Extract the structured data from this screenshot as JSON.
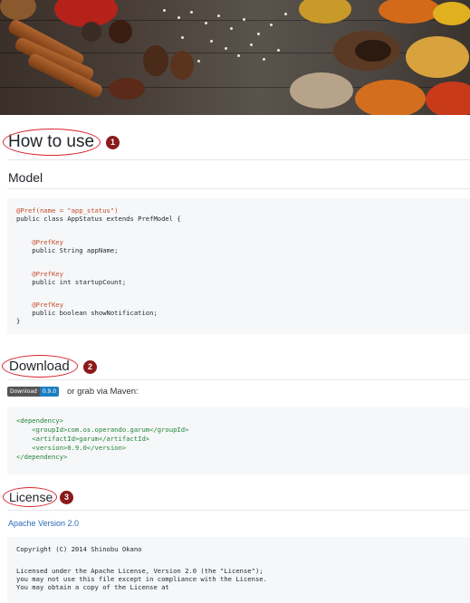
{
  "header_image": {
    "alt": ""
  },
  "sections": {
    "how_to_use": {
      "title": "How to use",
      "badge": "1"
    },
    "model": {
      "title": "Model"
    },
    "download": {
      "title": "Download",
      "badge": "2"
    },
    "license": {
      "title": "License",
      "badge": "3"
    }
  },
  "model_code": [
    "@Pref(name = \"app_status\")",
    "public class AppStatus extends PrefModel {",
    "",
    "    @PrefKey",
    "    public String appName;",
    "",
    "    @PrefKey",
    "    public int startupCount;",
    "",
    "    @PrefKey",
    "    public boolean showNotification;",
    "}"
  ],
  "download": {
    "badge_label": "Download",
    "badge_version": "0.9.0",
    "text": "or grab via Maven:"
  },
  "maven_code": [
    "<dependency>",
    "    <groupId>com.os.operando.garum</groupId>",
    "    <artifactId>garum</artifactId>",
    "    <version>0.9.0</version>",
    "</dependency>"
  ],
  "license": {
    "link_text": "Apache Version 2.0",
    "code": [
      "Copyright (C) 2014 Shinobu Okano",
      "",
      "Licensed under the Apache License, Version 2.0 (the \"License\");",
      "you may not use this file except in compliance with the License.",
      "You may obtain a copy of the License at"
    ]
  },
  "colors": {
    "marker": "#d9232e",
    "badge": "#8b1a1a",
    "link": "#2a6db5",
    "code_bg": "#f6f7f8"
  }
}
